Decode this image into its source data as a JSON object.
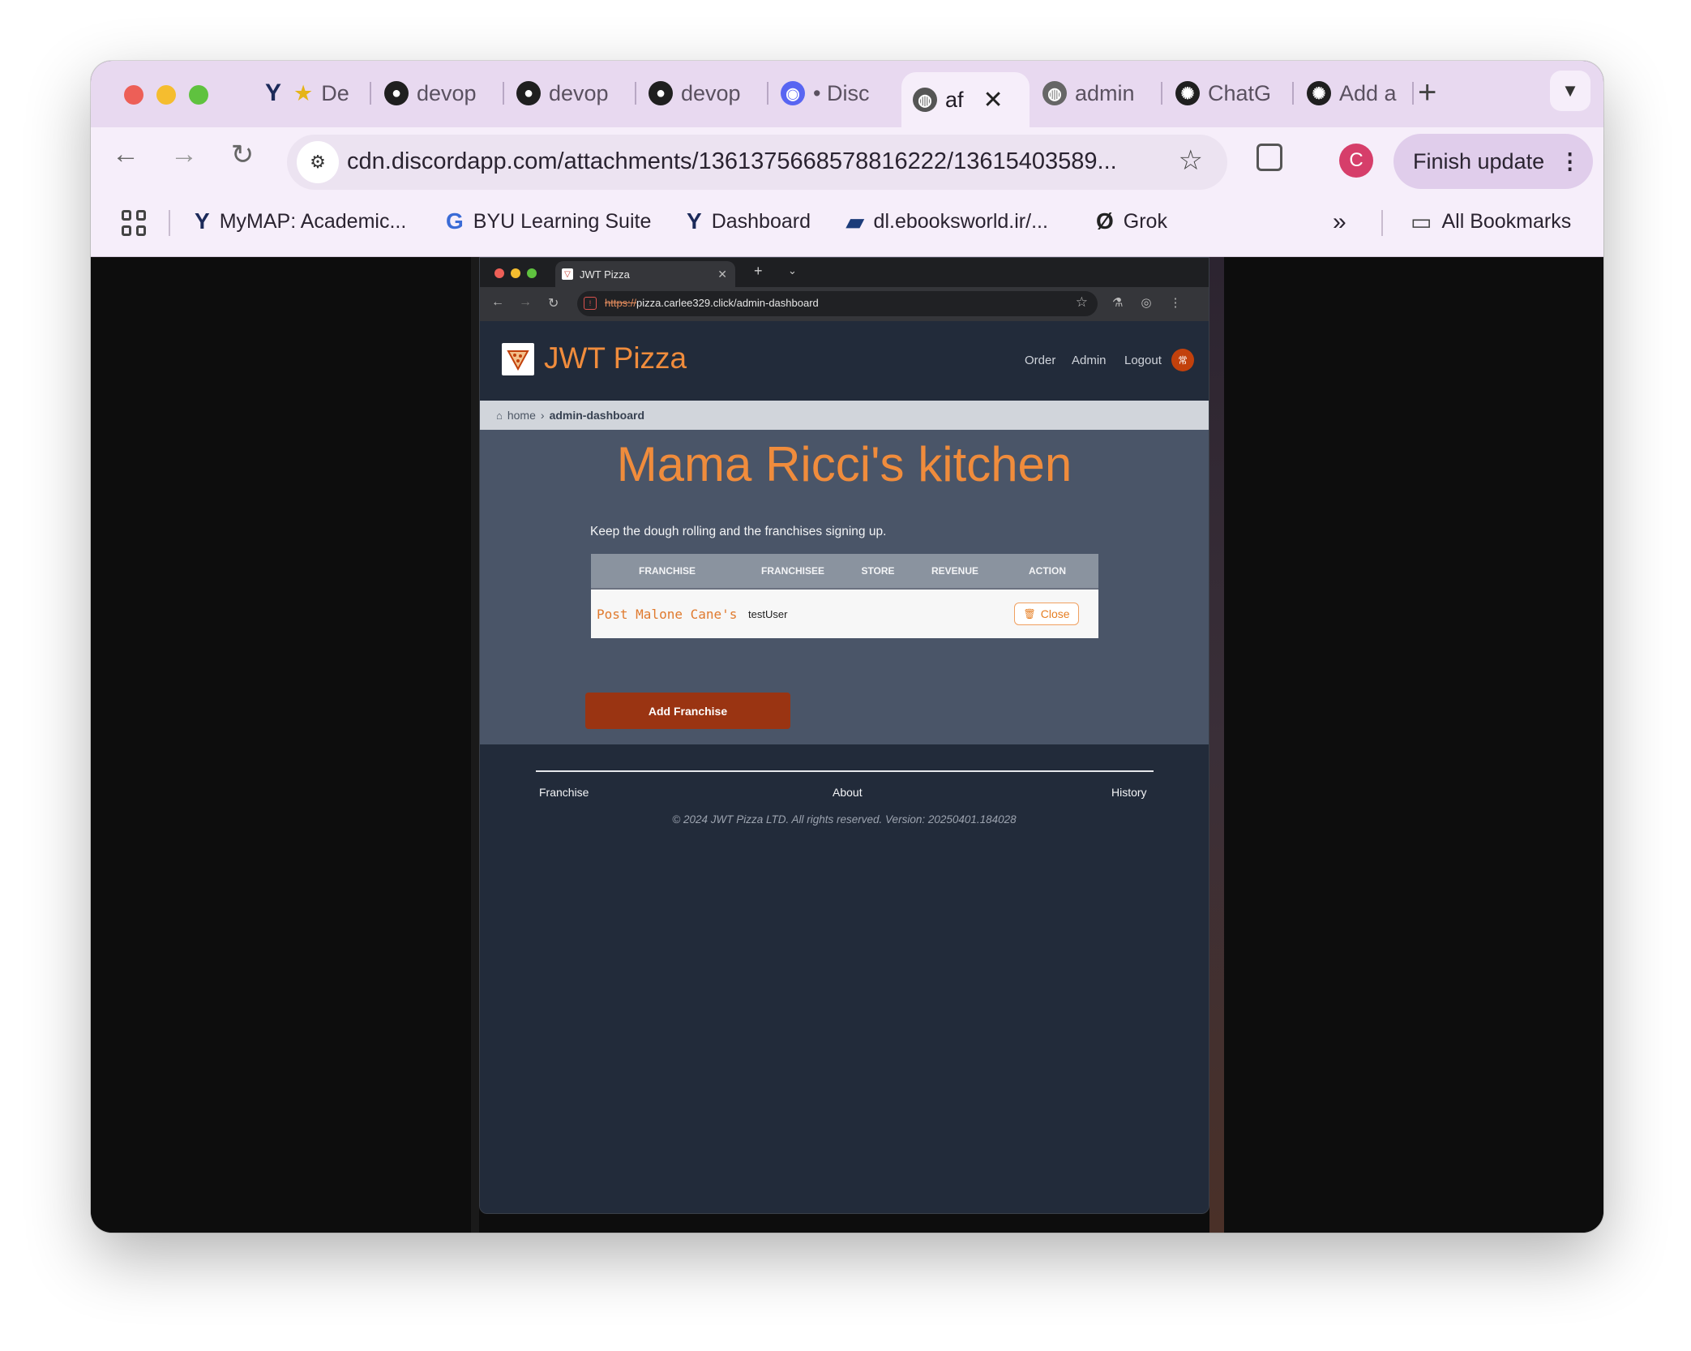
{
  "outer_browser": {
    "tabs": [
      {
        "label": "De"
      },
      {
        "label": "devop"
      },
      {
        "label": "devop"
      },
      {
        "label": "devop"
      },
      {
        "label": "• Disc"
      },
      {
        "label": "af"
      },
      {
        "label": "admin"
      },
      {
        "label": "ChatG"
      },
      {
        "label": "Add a"
      }
    ],
    "url": "cdn.discordapp.com/attachments/1361375668578816222/13615403589...",
    "profile_initial": "C",
    "finish_update_label": "Finish update",
    "bookmarks": [
      {
        "label": "MyMAP: Academic..."
      },
      {
        "label": "BYU Learning Suite"
      },
      {
        "label": "Dashboard"
      },
      {
        "label": "dl.ebooksworld.ir/..."
      },
      {
        "label": "Grok"
      }
    ],
    "all_bookmarks_label": "All Bookmarks"
  },
  "inner_browser": {
    "tab_title": "JWT Pizza",
    "url_scheme": "https://",
    "url_rest": "pizza.carlee329.click/admin-dashboard"
  },
  "app": {
    "brand": "JWT Pizza",
    "nav": {
      "order": "Order",
      "admin": "Admin",
      "logout": "Logout"
    },
    "avatar_initials": "常",
    "breadcrumb": {
      "home": "home",
      "current": "admin-dashboard"
    },
    "title": "Mama Ricci's kitchen",
    "tagline": "Keep the dough rolling and the franchises signing up.",
    "table": {
      "headers": [
        "FRANCHISE",
        "FRANCHISEE",
        "STORE",
        "REVENUE",
        "ACTION"
      ],
      "rows": [
        {
          "franchise": "Post Malone Cane's",
          "franchisee": "testUser",
          "action": "Close"
        }
      ]
    },
    "add_button": "Add Franchise",
    "footer": {
      "links": [
        "Franchise",
        "About",
        "History"
      ],
      "copyright": "© 2024 JWT Pizza LTD. All rights reserved. Version: 20250401.184028"
    }
  },
  "colors": {
    "accent_orange": "#f08c3c",
    "add_button": "#9a3412",
    "header_bg": "#222b3a",
    "main_bg": "#4a5568"
  }
}
